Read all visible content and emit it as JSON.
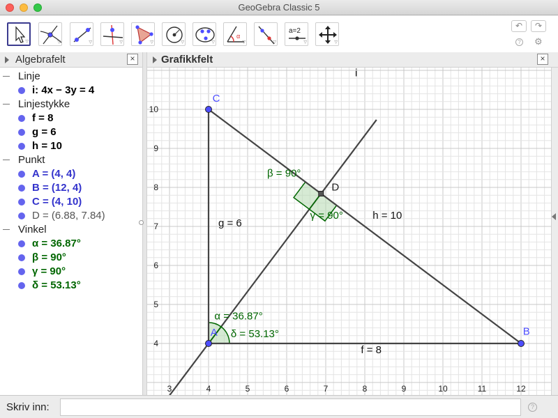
{
  "window": {
    "title": "GeoGebra Classic 5"
  },
  "toolbar": {
    "tools": [
      {
        "name": "move-tool",
        "icon": "arrow-cursor-icon"
      },
      {
        "name": "point-tool",
        "icon": "point-on-curves-icon"
      },
      {
        "name": "line-tool",
        "icon": "line-through-points-icon"
      },
      {
        "name": "perpendicular-line-tool",
        "icon": "perpendicular-line-icon"
      },
      {
        "name": "polygon-tool",
        "icon": "polygon-icon"
      },
      {
        "name": "circle-tool",
        "icon": "circle-center-point-icon"
      },
      {
        "name": "conic-tool",
        "icon": "ellipse-icon"
      },
      {
        "name": "angle-tool",
        "icon": "angle-icon"
      },
      {
        "name": "reflect-tool",
        "icon": "reflect-line-icon"
      },
      {
        "name": "slider-tool",
        "icon": "slider-icon",
        "label": "a=2"
      },
      {
        "name": "move-graphics-view-tool",
        "icon": "move-view-icon"
      }
    ],
    "undo_icon": "undo-icon",
    "redo_icon": "redo-icon",
    "help_label": "?",
    "settings_icon": "gear-icon"
  },
  "algebra": {
    "title": "Algebrafelt",
    "close_label": "×",
    "categories": [
      {
        "label": "Linje",
        "items": [
          {
            "text": "i: 4x − 3y = 4",
            "color": "#000000"
          }
        ]
      },
      {
        "label": "Linjestykke",
        "items": [
          {
            "text": "f = 8",
            "color": "#000000"
          },
          {
            "text": "g = 6",
            "color": "#000000"
          },
          {
            "text": "h = 10",
            "color": "#000000"
          }
        ]
      },
      {
        "label": "Punkt",
        "items": [
          {
            "text": "A = (4, 4)",
            "color": "#3333cc"
          },
          {
            "text": "B = (12, 4)",
            "color": "#3333cc"
          },
          {
            "text": "C = (4, 10)",
            "color": "#3333cc"
          },
          {
            "text": "D = (6.88, 7.84)",
            "color": "#555555"
          }
        ]
      },
      {
        "label": "Vinkel",
        "items": [
          {
            "text": "α = 36.87°",
            "color": "#006600"
          },
          {
            "text": "β = 90°",
            "color": "#006600"
          },
          {
            "text": "γ = 90°",
            "color": "#006600"
          },
          {
            "text": "δ = 53.13°",
            "color": "#006600"
          }
        ]
      }
    ]
  },
  "graphics": {
    "title": "Grafikkfelt",
    "close_label": "×",
    "x_ticks": [
      "3",
      "4",
      "5",
      "6",
      "7",
      "8",
      "9",
      "10",
      "11",
      "12"
    ],
    "y_ticks": [
      "4",
      "5",
      "6",
      "7",
      "8",
      "9",
      "10"
    ],
    "points": [
      {
        "name": "A",
        "x": 4,
        "y": 4,
        "color": "#4d4dff"
      },
      {
        "name": "B",
        "x": 12,
        "y": 4,
        "color": "#4d4dff"
      },
      {
        "name": "C",
        "x": 4,
        "y": 10,
        "color": "#4d4dff"
      },
      {
        "name": "D",
        "x": 6.88,
        "y": 7.84,
        "color": "#444444"
      }
    ],
    "segments": [
      {
        "name": "f",
        "label": "f = 8",
        "from": "A",
        "to": "B"
      },
      {
        "name": "g",
        "label": "g = 6",
        "from": "A",
        "to": "C"
      },
      {
        "name": "h",
        "label": "h = 10",
        "from": "C",
        "to": "B"
      }
    ],
    "line": {
      "name": "i",
      "equation": "4x − 3y = 4"
    },
    "angles": [
      {
        "name": "alpha",
        "label": "α = 36.87°"
      },
      {
        "name": "delta",
        "label": "δ = 53.13°"
      },
      {
        "name": "beta",
        "label": "β = 90°"
      },
      {
        "name": "gamma",
        "label": "γ = 90°"
      }
    ],
    "colors": {
      "segment": "#444444",
      "angle": "#006600",
      "angle_fill": "#b5d9b0",
      "grid": "#e4e4e4",
      "grid_major": "#c8c8c8"
    }
  },
  "input": {
    "label": "Skriv inn:",
    "value": "",
    "help_label": "?"
  }
}
